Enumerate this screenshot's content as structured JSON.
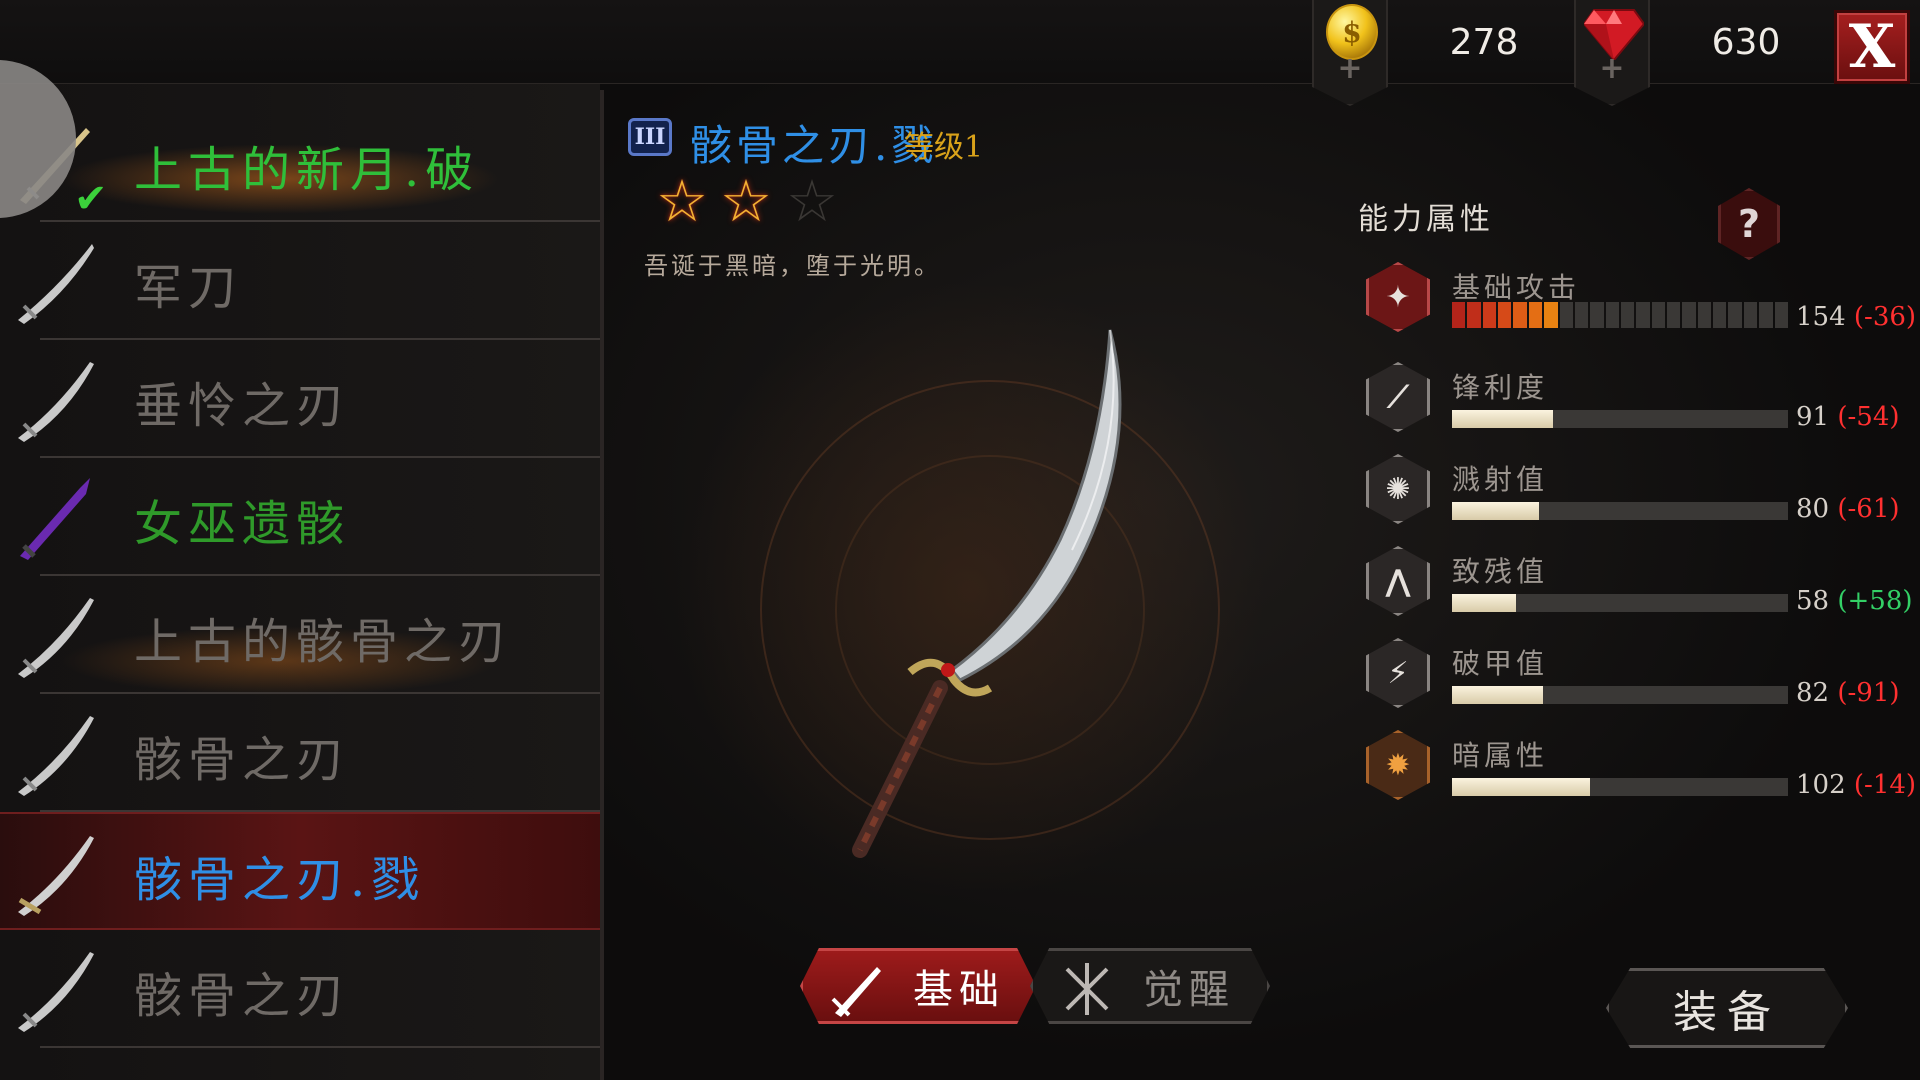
{
  "currency": {
    "gold": {
      "icon": "gold-coin-icon",
      "value": "278",
      "plus": "+"
    },
    "gem": {
      "icon": "red-gem-icon",
      "value": "630",
      "plus": "+"
    }
  },
  "close_label": "X",
  "weapon_list": [
    {
      "name": "上古的新月.破",
      "color": "#2fbf3a",
      "state": "equipped"
    },
    {
      "name": "军刀",
      "color": "#6f6a66"
    },
    {
      "name": "垂怜之刃",
      "color": "#6f6a66"
    },
    {
      "name": "女巫遗骸",
      "color": "#2f9a2a"
    },
    {
      "name": "上古的骸骨之刃",
      "color": "#6f6a66"
    },
    {
      "name": "骸骨之刃",
      "color": "#6f6a66"
    },
    {
      "name": "骸骨之刃.戮",
      "color": "#2f8fe6",
      "state": "selected"
    },
    {
      "name": "骸骨之刃",
      "color": "#6f6a66"
    }
  ],
  "detail": {
    "rank": "III",
    "name": "骸骨之刃.戮",
    "level": "等级1",
    "stars_filled": 2,
    "stars_total": 3,
    "description": "吾诞于黑暗，堕于光明。"
  },
  "stats": {
    "title": "能力属性",
    "help": "?",
    "items": [
      {
        "name": "基础攻击",
        "icon": "attack-icon",
        "value": "154",
        "delta": "(-36)",
        "delta_type": "neg",
        "fraction": 0.3
      },
      {
        "name": "锋利度",
        "icon": "sharpness-icon",
        "value": "91",
        "delta": "(-54)",
        "delta_type": "neg",
        "fraction": 0.3
      },
      {
        "name": "溅射值",
        "icon": "splash-icon",
        "value": "80",
        "delta": "(-61)",
        "delta_type": "neg",
        "fraction": 0.26
      },
      {
        "name": "致残值",
        "icon": "cripple-icon",
        "value": "58",
        "delta": "(+58)",
        "delta_type": "pos",
        "fraction": 0.19
      },
      {
        "name": "破甲值",
        "icon": "armor-break-icon",
        "value": "82",
        "delta": "(-91)",
        "delta_type": "neg",
        "fraction": 0.27
      },
      {
        "name": "暗属性",
        "icon": "dark-element-icon",
        "value": "102",
        "delta": "(-14)",
        "delta_type": "neg",
        "fraction": 0.41
      }
    ]
  },
  "tabs": {
    "basic": "基础",
    "awaken": "觉醒"
  },
  "equip_label": "装备"
}
